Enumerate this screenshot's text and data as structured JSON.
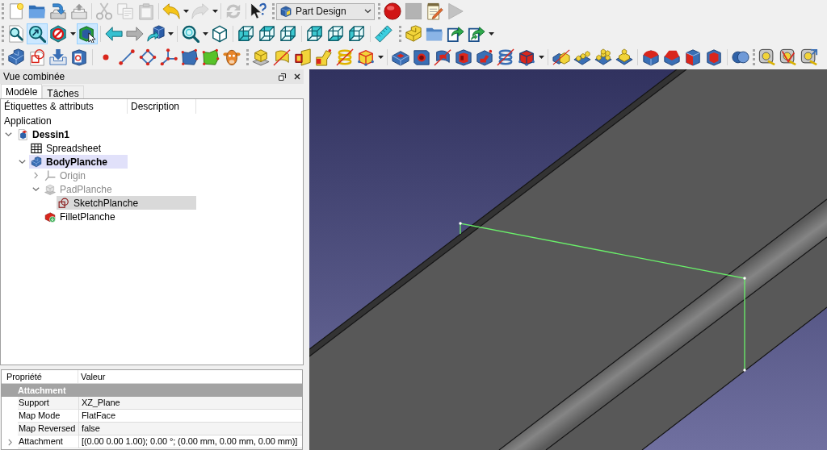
{
  "main_toolbar": [
    {
      "disabled": false
    },
    {
      "disabled": false
    },
    {
      "disabled": false
    },
    {
      "disabled": false
    },
    {
      "disabled": true
    },
    {
      "disabled": true
    },
    {
      "disabled": true
    },
    {
      "disabled": false
    },
    {
      "disabled": true
    },
    {
      "disabled": true
    },
    {
      "disabled": false
    }
  ],
  "workbench": {
    "label": "Part Design"
  },
  "macro_toolbar": [
    {
      "disabled": false
    },
    {
      "disabled": true
    },
    {
      "disabled": false
    },
    {
      "disabled": true
    }
  ],
  "view_toolbar": [
    {
      "pressed": false
    },
    {
      "pressed": true
    },
    {
      "pressed": false
    },
    {
      "pressed": true
    }
  ],
  "panel": {
    "title": "Vue combinée",
    "tabs": [
      {
        "label": "Modèle",
        "selected": true
      },
      {
        "label": "Tâches",
        "selected": false
      }
    ]
  },
  "tree": {
    "columns": [
      "Étiquettes & attributs",
      "Description"
    ],
    "items": [
      {
        "label": "Application",
        "active": false,
        "visible": true,
        "selected": false,
        "children": [
          {
            "label": "Dessin1",
            "kind": "document",
            "active": true,
            "visible": true,
            "selected": false,
            "expanded": true,
            "children": [
              {
                "label": "Spreadsheet",
                "kind": "spreadsheet",
                "active": false,
                "visible": true,
                "selected": false
              },
              {
                "label": "BodyPlanche",
                "kind": "body",
                "active": true,
                "visible": true,
                "selected": false,
                "expanded": true,
                "children": [
                  {
                    "label": "Origin",
                    "kind": "origin",
                    "active": false,
                    "visible": false,
                    "selected": false,
                    "expanded": false
                  },
                  {
                    "label": "PadPlanche",
                    "kind": "pad",
                    "active": false,
                    "visible": false,
                    "selected": false,
                    "expanded": true,
                    "children": [
                      {
                        "label": "SketchPlanche",
                        "kind": "sketch",
                        "active": false,
                        "visible": true,
                        "selected": true
                      }
                    ]
                  },
                  {
                    "label": "FilletPlanche",
                    "kind": "fillet",
                    "active": false,
                    "visible": true,
                    "selected": false
                  }
                ]
              }
            ]
          }
        ]
      }
    ]
  },
  "properties": {
    "columns": [
      "Propriété",
      "Valeur"
    ],
    "groups": [
      {
        "name": "Attachment",
        "rows": [
          {
            "name": "Support",
            "value": "XZ_Plane"
          },
          {
            "name": "Map Mode",
            "value": "FlatFace"
          },
          {
            "name": "Map Reversed",
            "value": "false"
          },
          {
            "name": "Attachment",
            "value": "[(0.00 0.00 1.00); 0.00 °; (0.00 mm, 0.00 mm, 0.00 mm)]",
            "expanded": false
          }
        ]
      }
    ]
  }
}
